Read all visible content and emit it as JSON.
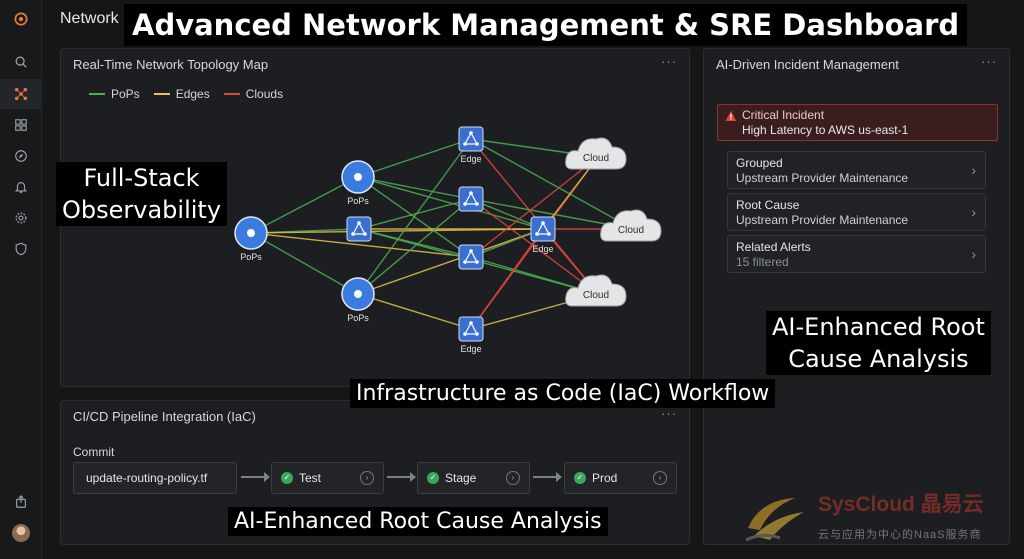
{
  "app": {
    "page_title": "Network"
  },
  "overlays": {
    "headline": "Advanced Network Management & SRE Dashboard",
    "observability_line1": "Full-Stack",
    "observability_line2": "Observability",
    "rca_right_line1": "AI-Enhanced Root",
    "rca_right_line2": "Cause Analysis",
    "iac_caption": "Infrastructure  as Code (IaC) Workflow",
    "rca_bottom": "AI-Enhanced Root Cause Analysis"
  },
  "sidebar": {
    "items": [
      {
        "icon": "search-icon"
      },
      {
        "icon": "topology-icon",
        "active": true
      },
      {
        "icon": "grid-icon"
      },
      {
        "icon": "compass-icon"
      },
      {
        "icon": "bell-icon"
      },
      {
        "icon": "gear-icon"
      },
      {
        "icon": "shield-icon"
      },
      {
        "icon": "share-icon"
      },
      {
        "icon": "avatar"
      }
    ]
  },
  "topology": {
    "title": "Real-Time Network Topology Map",
    "menu": "···",
    "legend": [
      {
        "label": "PoPs",
        "color": "#4caf50"
      },
      {
        "label": "Edges",
        "color": "#e6c34a"
      },
      {
        "label": "Clouds",
        "color": "#e0473c"
      }
    ],
    "node_labels": {
      "pop": "PoPs",
      "edge": "Edge",
      "cloud": "Cloud"
    },
    "colors": {
      "pop_node": "#3b7be0",
      "edge_node": "#3a6fd0",
      "cloud_fill": "#e4e5e6"
    }
  },
  "incidents": {
    "title": "AI-Driven Incident Management",
    "menu": "···",
    "critical": {
      "title": "Critical Incident",
      "detail": "High Latency to AWS us-east-1",
      "color": "#e0473c"
    },
    "cards": [
      {
        "label": "Grouped",
        "value": "Upstream Provider Maintenance"
      },
      {
        "label": "Root Cause",
        "value": "Upstream Provider Maintenance"
      },
      {
        "label": "Related Alerts",
        "value": "15 filtered"
      }
    ]
  },
  "pipeline": {
    "title": "CI/CD Pipeline Integration (IaC)",
    "menu": "···",
    "commit_label": "Commit",
    "commit_file": "update-routing-policy.tf",
    "stages": [
      {
        "name": "Test",
        "status": "passed"
      },
      {
        "name": "Stage",
        "status": "passed"
      },
      {
        "name": "Prod",
        "status": "passed"
      }
    ]
  },
  "watermark": {
    "brand": "SysCloud 晶易云",
    "tagline": "云与应用为中心的NaaS服务商"
  }
}
